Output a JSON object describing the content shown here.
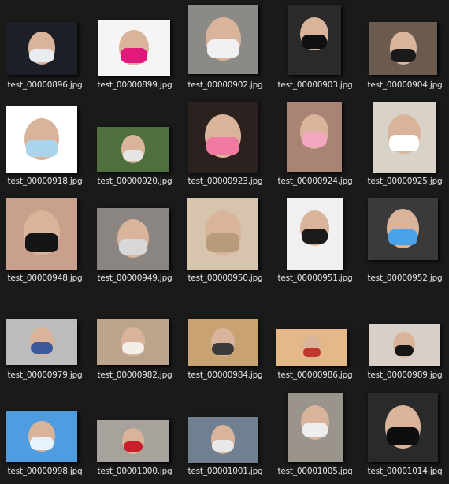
{
  "files": [
    {
      "name": "test_00000896.jpg",
      "thumb": "group-masked-faces",
      "bg": "#1d1f26",
      "mask": "#e9ecef"
    },
    {
      "name": "test_00000899.jpg",
      "thumb": "couple-pink-black-masks",
      "bg": "#f5f5f5",
      "mask": "#e0197a"
    },
    {
      "name": "test_00000902.jpg",
      "thumb": "person-hand-over-mouth",
      "bg": "#8c8a86",
      "mask": "#f0f0f0"
    },
    {
      "name": "test_00000903.jpg",
      "thumb": "black-patterned-mask",
      "bg": "#2a2a2a",
      "mask": "#101010"
    },
    {
      "name": "test_00000904.jpg",
      "thumb": "black-mask-closeup",
      "bg": "#6b5a4e",
      "mask": "#1a1a1a"
    },
    {
      "name": "test_00000918.jpg",
      "thumb": "surgical-mask-woman",
      "bg": "#ffffff",
      "mask": "#a9d4ec"
    },
    {
      "name": "test_00000920.jpg",
      "thumb": "woman-by-car",
      "bg": "#4f6f3c",
      "mask": "#e5e5e5"
    },
    {
      "name": "test_00000923.jpg",
      "thumb": "pink-cat-mask",
      "bg": "#2b211e",
      "mask": "#f07aa0"
    },
    {
      "name": "test_00000924.jpg",
      "thumb": "pink-heart-mask",
      "bg": "#a98374",
      "mask": "#f3a6bf"
    },
    {
      "name": "test_00000925.jpg",
      "thumb": "man-walking-street",
      "bg": "#d9d2c8",
      "mask": "#ffffff"
    },
    {
      "name": "test_00000948.jpg",
      "thumb": "family-selfie",
      "bg": "#c9a08c",
      "mask": "#151515"
    },
    {
      "name": "test_00000949.jpg",
      "thumb": "woman-grey-mask",
      "bg": "#8a8580",
      "mask": "#d8d8d8"
    },
    {
      "name": "test_00000950.jpg",
      "thumb": "plaid-shirt-mask",
      "bg": "#d7c4ac",
      "mask": "#b89b7b"
    },
    {
      "name": "test_00000951.jpg",
      "thumb": "printed-mask-collage",
      "bg": "#f0f0f0",
      "mask": "#1a1a1a"
    },
    {
      "name": "test_00000952.jpg",
      "thumb": "doraemon-mask",
      "bg": "#3a3a3a",
      "mask": "#4aa2e8"
    },
    {
      "name": "test_00000979.jpg",
      "thumb": "street-legs",
      "bg": "#bcbcbc",
      "mask": "#3c5a9b"
    },
    {
      "name": "test_00000982.jpg",
      "thumb": "woman-face-veil",
      "bg": "#bba48b",
      "mask": "#f4eee8"
    },
    {
      "name": "test_00000984.jpg",
      "thumb": "hazy-street-person",
      "bg": "#c8a273",
      "mask": "#3a3a3a"
    },
    {
      "name": "test_00000986.jpg",
      "thumb": "smog-cyclists",
      "bg": "#e5b889",
      "mask": "#c0392b"
    },
    {
      "name": "test_00000989.jpg",
      "thumb": "black-mask-man",
      "bg": "#d8d0c8",
      "mask": "#161616"
    },
    {
      "name": "test_00000998.jpg",
      "thumb": "woman-blue-sky-mask",
      "bg": "#4f9de0",
      "mask": "#e8f2fa"
    },
    {
      "name": "test_00001000.jpg",
      "thumb": "red-coat-street",
      "bg": "#a7a29b",
      "mask": "#c8202a"
    },
    {
      "name": "test_00001001.jpg",
      "thumb": "couple-masks-outdoor",
      "bg": "#708090",
      "mask": "#e8e8e8"
    },
    {
      "name": "test_00001005.jpg",
      "thumb": "man-walking-haze",
      "bg": "#9a948c",
      "mask": "#eeeeee"
    },
    {
      "name": "test_00001014.jpg",
      "thumb": "couple-black-masks",
      "bg": "#2a2a2a",
      "mask": "#0e0e0e"
    }
  ]
}
